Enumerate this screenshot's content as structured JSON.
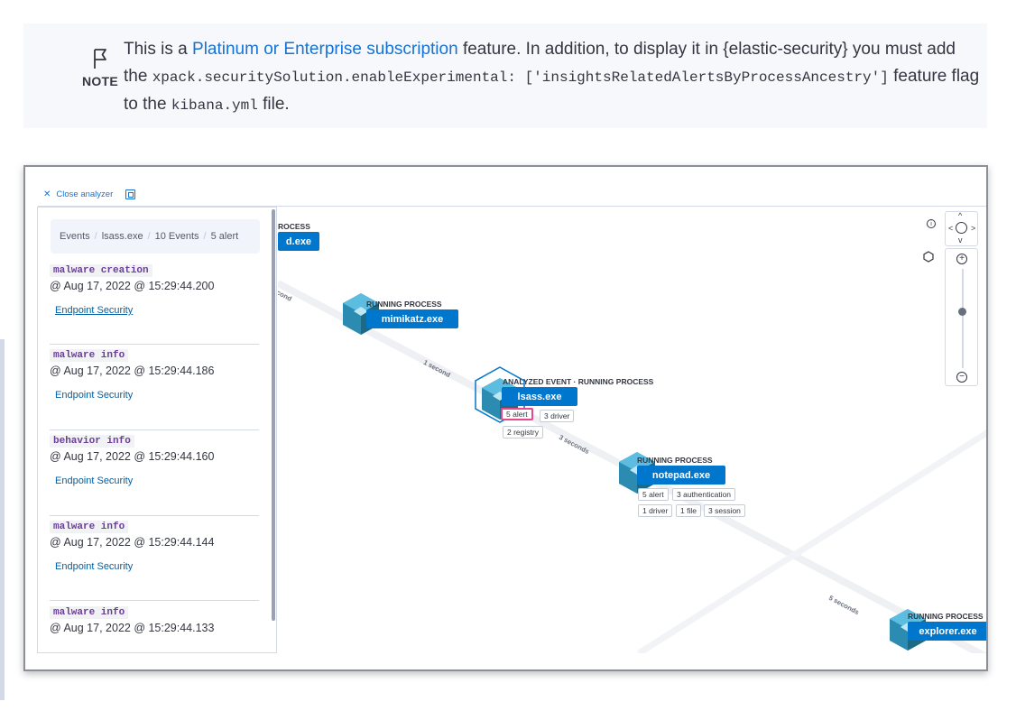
{
  "note": {
    "label": "NOTE",
    "text_before": "This is a ",
    "link": "Platinum or Enterprise subscription",
    "text_mid1": " feature. In addition, to display it in {elastic-security} you must add the ",
    "code1": "xpack.securitySolution.enableExperimental: ['insightsRelatedAlertsByProcessAncestry']",
    "text_mid2": " feature flag to the ",
    "code2": "kibana.yml",
    "text_after": " file."
  },
  "analyzer": {
    "close_label": "Close analyzer",
    "breadcrumbs": [
      "Events",
      "lsass.exe",
      "10 Events",
      "5 alert"
    ],
    "events": [
      {
        "category": "malware creation",
        "time": "@ Aug 17, 2022 @ 15:29:44.200",
        "link": "Endpoint Security"
      },
      {
        "category": "malware info",
        "time": "@ Aug 17, 2022 @ 15:29:44.186",
        "link": "Endpoint Security"
      },
      {
        "category": "behavior info",
        "time": "@ Aug 17, 2022 @ 15:29:44.160",
        "link": "Endpoint Security"
      },
      {
        "category": "malware info",
        "time": "@ Aug 17, 2022 @ 15:29:44.144",
        "link": "Endpoint Security"
      },
      {
        "category": "malware info",
        "time": "@ Aug 17, 2022 @ 15:29:44.133",
        "link": ""
      }
    ],
    "nodes": {
      "top": {
        "title": "ROCESS",
        "name": "d.exe"
      },
      "mimikatz": {
        "title": "RUNNING PROCESS",
        "name": "mimikatz.exe"
      },
      "lsass": {
        "title": "ANALYZED EVENT · RUNNING PROCESS",
        "name": "lsass.exe",
        "pills": [
          "5 alert",
          "3 driver",
          "2 registry"
        ]
      },
      "notepad": {
        "title": "RUNNING PROCESS",
        "name": "notepad.exe",
        "pills": [
          "5 alert",
          "3 authentication",
          "1 driver",
          "1 file",
          "3 session"
        ]
      },
      "explorer": {
        "title": "RUNNING PROCESS",
        "name": "explorer.exe"
      }
    },
    "edges": [
      "cond",
      "1 second",
      "3 seconds",
      "5 seconds"
    ],
    "controls": {
      "info_glyph": "i",
      "zoom_in": "+",
      "zoom_out": "−",
      "up": "^",
      "down": "v",
      "left": "<",
      "right": ">"
    }
  }
}
